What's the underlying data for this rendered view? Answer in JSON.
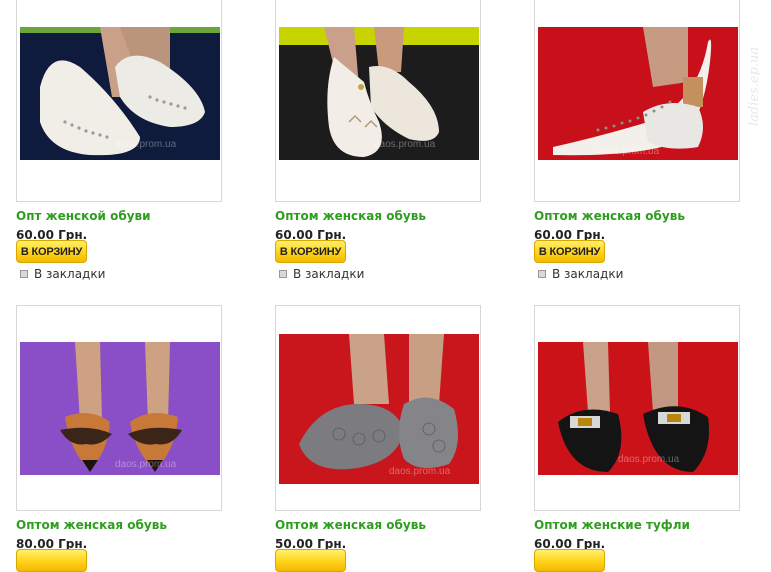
{
  "products": [
    {
      "title": "Опт женской обуви",
      "price": "60.00 Грн.",
      "cart_label": "В КОРЗИНУ",
      "bookmark_label": "В закладки",
      "watermark": "daos.prom.ua"
    },
    {
      "title": "Оптом женская обувь",
      "price": "60.00 Грн.",
      "cart_label": "В КОРЗИНУ",
      "bookmark_label": "В закладки",
      "watermark": "daos.prom.ua"
    },
    {
      "title": "Оптом женская обувь",
      "price": "60.00 Грн.",
      "cart_label": "В КОРЗИНУ",
      "bookmark_label": "В закладки",
      "watermark": "daos.prom.ua"
    },
    {
      "title": "Оптом женская обувь",
      "price": "80.00 Грн.",
      "watermark": "daos.prom.ua"
    },
    {
      "title": "Оптом женская обувь",
      "price": "50.00 Грн.",
      "watermark": "daos.prom.ua"
    },
    {
      "title": "Оптом женские туфли",
      "price": "60.00 Грн.",
      "watermark": "daos.prom.ua"
    }
  ],
  "side_watermark": "ladies.ep.ua",
  "colors": {
    "title": "#2e9e1f",
    "button": "#ffd21a",
    "price": "#222222"
  }
}
